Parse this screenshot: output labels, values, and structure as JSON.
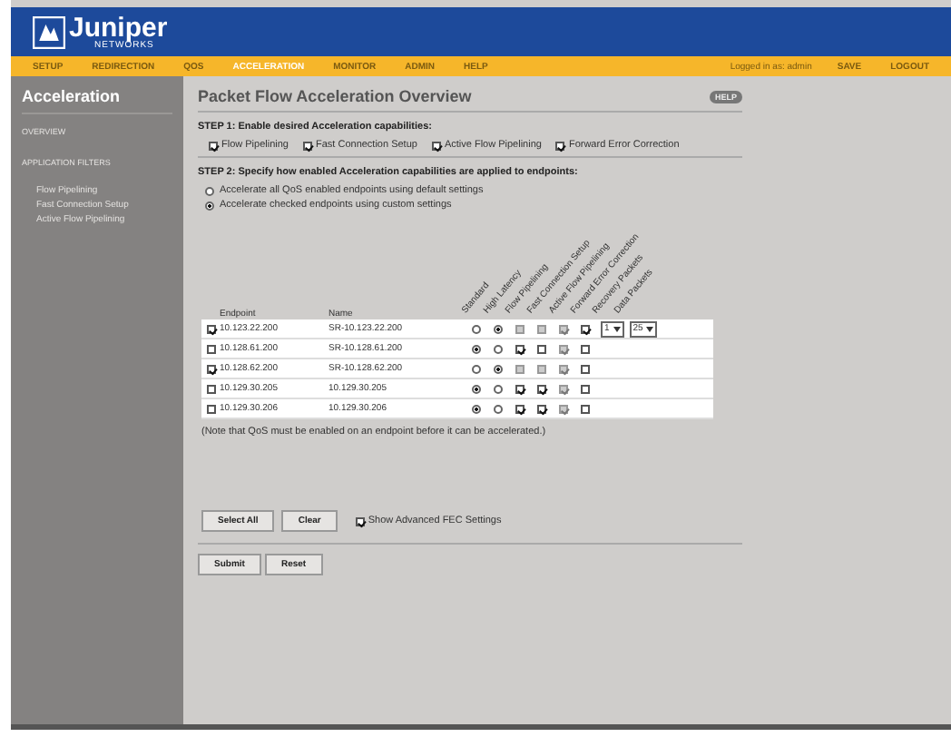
{
  "logo": {
    "text": "Juniper",
    "subtext": "NETWORKS"
  },
  "nav": {
    "items": [
      {
        "label": "SETUP",
        "selected": false
      },
      {
        "label": "REDIRECTION",
        "selected": false
      },
      {
        "label": "QOS",
        "selected": false
      },
      {
        "label": "ACCELERATION",
        "selected": true
      },
      {
        "label": "MONITOR",
        "selected": false
      },
      {
        "label": "ADMIN",
        "selected": false
      },
      {
        "label": "HELP",
        "selected": false
      }
    ],
    "user": "Logged in as: admin",
    "actions": [
      "SAVE",
      "LOGOUT"
    ]
  },
  "sidebar": {
    "title": "Acceleration",
    "items": [
      {
        "label": "OVERVIEW",
        "kind": "section"
      },
      {
        "label": "APPLICATION FILTERS",
        "kind": "section"
      },
      {
        "label": "Flow Pipelining",
        "kind": "link"
      },
      {
        "label": "Fast Connection Setup",
        "kind": "link"
      },
      {
        "label": "Active Flow Pipelining",
        "kind": "link"
      }
    ]
  },
  "page": {
    "title": "Packet Flow Acceleration Overview",
    "help": "HELP",
    "step1": {
      "heading": "STEP 1: Enable desired Acceleration capabilities:",
      "options": [
        {
          "label": "Flow Pipelining",
          "checked": true
        },
        {
          "label": "Fast Connection Setup",
          "checked": true
        },
        {
          "label": "Active Flow Pipelining",
          "checked": true
        },
        {
          "label": "Forward Error Correction",
          "checked": true
        }
      ]
    },
    "step2": {
      "heading": "STEP 2: Specify how enabled Acceleration capabilities are applied to endpoints:",
      "modes": [
        {
          "label": "Accelerate all QoS enabled endpoints using default settings",
          "selected": false
        },
        {
          "label": "Accelerate checked endpoints using custom settings",
          "selected": true
        }
      ]
    },
    "table": {
      "columns": [
        "Endpoint",
        "Name",
        "Standard",
        "High Latency",
        "Flow Pipelining",
        "Fast Connection Setup",
        "Active Flow Pipelining",
        "Forward Error Correction",
        "Recovery Packets",
        "Data Packets"
      ],
      "rows": [
        {
          "checked": true,
          "endpoint": "10.123.22.200",
          "name": "SR-10.123.22.200",
          "latency": [
            {
              "selected": false
            },
            {
              "selected": true
            }
          ],
          "flags": [
            {
              "checked": false,
              "disabled": true
            },
            {
              "checked": false,
              "disabled": true
            },
            {
              "checked": true,
              "disabled": true
            },
            {
              "checked": true,
              "disabled": false
            }
          ],
          "recovery": "1",
          "data": "25"
        },
        {
          "checked": false,
          "endpoint": "10.128.61.200",
          "name": "SR-10.128.61.200",
          "latency": [
            {
              "selected": true
            },
            {
              "selected": false
            }
          ],
          "flags": [
            {
              "checked": true,
              "disabled": false
            },
            {
              "checked": false,
              "disabled": false
            },
            {
              "checked": true,
              "disabled": true
            },
            {
              "checked": false,
              "disabled": false
            }
          ]
        },
        {
          "checked": true,
          "endpoint": "10.128.62.200",
          "name": "SR-10.128.62.200",
          "latency": [
            {
              "selected": false
            },
            {
              "selected": true
            }
          ],
          "flags": [
            {
              "checked": false,
              "disabled": true
            },
            {
              "checked": false,
              "disabled": true
            },
            {
              "checked": true,
              "disabled": true
            },
            {
              "checked": false,
              "disabled": false
            }
          ]
        },
        {
          "checked": false,
          "endpoint": "10.129.30.205",
          "name": "10.129.30.205",
          "latency": [
            {
              "selected": true
            },
            {
              "selected": false
            }
          ],
          "flags": [
            {
              "checked": true,
              "disabled": false
            },
            {
              "checked": true,
              "disabled": false
            },
            {
              "checked": true,
              "disabled": true
            },
            {
              "checked": false,
              "disabled": false
            }
          ]
        },
        {
          "checked": false,
          "endpoint": "10.129.30.206",
          "name": "10.129.30.206",
          "latency": [
            {
              "selected": true
            },
            {
              "selected": false
            }
          ],
          "flags": [
            {
              "checked": true,
              "disabled": false
            },
            {
              "checked": true,
              "disabled": false
            },
            {
              "checked": true,
              "disabled": true
            },
            {
              "checked": false,
              "disabled": false
            }
          ]
        }
      ]
    },
    "note": "(Note that QoS must be enabled on an endpoint before it can be accelerated.)",
    "table_buttons": [
      "Select All",
      "Clear"
    ],
    "advanced": {
      "label": "Show Advanced FEC Settings",
      "checked": true
    },
    "form_buttons": [
      "Submit",
      "Reset"
    ]
  }
}
